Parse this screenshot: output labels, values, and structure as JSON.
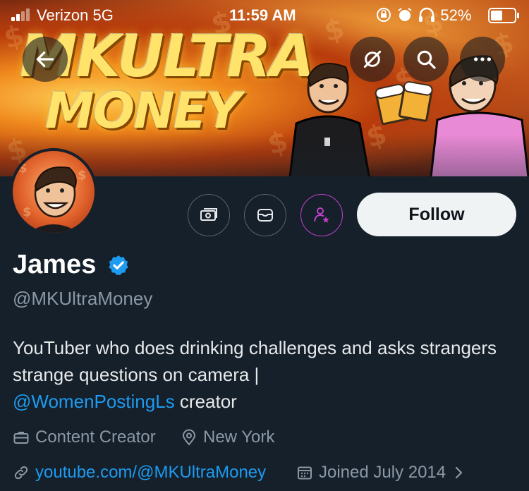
{
  "status_bar": {
    "carrier": "Verizon  5G",
    "time": "11:59 AM",
    "battery": "52%"
  },
  "banner": {
    "brand_line1": "MKULTRA",
    "brand_line2": "MONEY"
  },
  "nav": {
    "back_icon": "arrow-left-icon",
    "grok_icon": "grok-icon",
    "search_icon": "search-icon",
    "more_icon": "more-icon"
  },
  "actions": {
    "subscribe_icon": "money-icon",
    "message_icon": "envelope-icon",
    "notify_icon": "person-star-icon",
    "follow_label": "Follow"
  },
  "profile": {
    "name": "James",
    "handle": "@MKUltraMoney",
    "bio_text": "YouTuber who does drinking challenges and asks strangers strange questions on camera |",
    "bio_mention": "@WomenPostingLs",
    "bio_tail": " creator",
    "category": "Content Creator",
    "location": "New York",
    "website": "youtube.com/@MKUltraMoney",
    "joined": "Joined July 2014"
  },
  "colors": {
    "background": "#15202b",
    "accent": "#1d9bf0",
    "muted": "#8b98a5",
    "purple": "#c23fc9"
  }
}
